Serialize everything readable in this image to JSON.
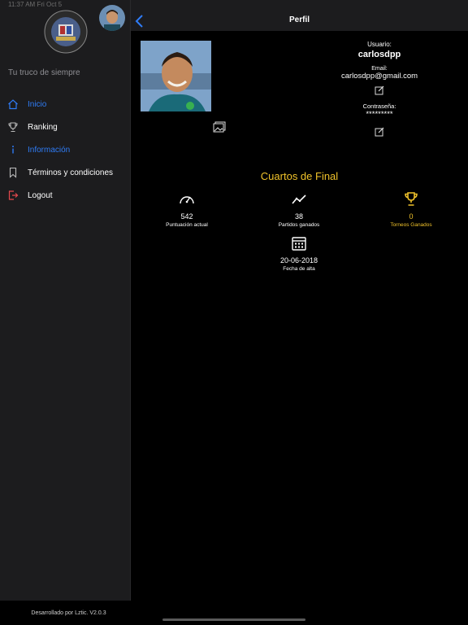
{
  "status_bar": {
    "time": "11:37 AM",
    "date": "Fri Oct 5"
  },
  "sidebar": {
    "tagline": "Tu truco de siempre",
    "items": [
      {
        "label": "Inicio",
        "icon": "home-icon",
        "active": true
      },
      {
        "label": "Ranking",
        "icon": "trophy-icon"
      },
      {
        "label": "Información",
        "icon": "info-icon"
      },
      {
        "label": "Términos y condiciones",
        "icon": "bookmark-icon"
      },
      {
        "label": "Logout",
        "icon": "logout-icon"
      }
    ],
    "footer": "Desarrollado por Lztic. V2.0.3"
  },
  "nav": {
    "title": "Perfil",
    "back_icon": "chevron-left-icon"
  },
  "profile": {
    "user_label": "Usuario:",
    "username": "carlosdpp",
    "email_label": "Email:",
    "email": "carlosdpp@gmail.com",
    "password_label": "Contraseña:",
    "password": "*********"
  },
  "stage": "Cuartos de Final",
  "stats": {
    "score": {
      "value": "542",
      "label": "Puntuación actual",
      "icon": "speedometer-icon"
    },
    "matches": {
      "value": "38",
      "label": "Partidos ganados",
      "icon": "trend-icon"
    },
    "tournaments": {
      "value": "0",
      "label": "Torneos Ganados",
      "icon": "trophy-icon"
    },
    "joined": {
      "value": "20-06-2018",
      "label": "Fecha de alta",
      "icon": "calendar-icon"
    }
  },
  "colors": {
    "accent": "#2f7cf6",
    "gold": "#f0c22a",
    "logout": "#e5484d",
    "sidebar_bg": "#1c1c1e"
  }
}
